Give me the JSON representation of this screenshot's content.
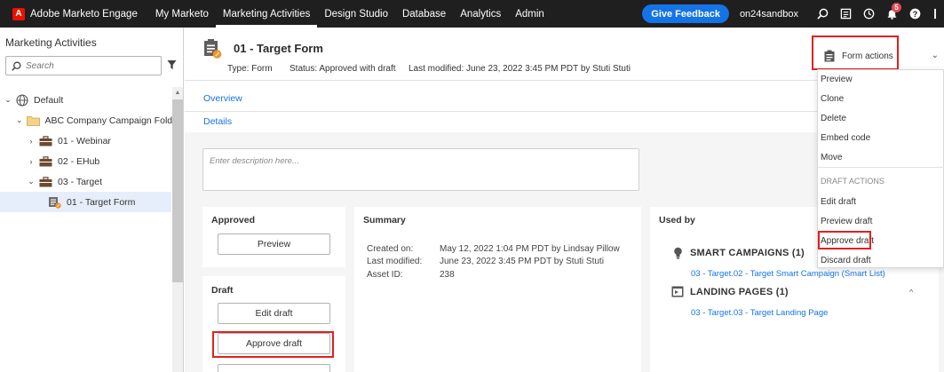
{
  "topnav": {
    "brand": "Adobe Marketo Engage",
    "items": [
      "My Marketo",
      "Marketing Activities",
      "Design Studio",
      "Database",
      "Analytics",
      "Admin"
    ],
    "feedback": "Give Feedback",
    "sandbox": "on24sandbox",
    "notification_count": "5"
  },
  "sidebar": {
    "title": "Marketing Activities",
    "search_placeholder": "Search",
    "tree": {
      "default": "Default",
      "folder": "ABC Company Campaign Folder",
      "webinar": "01 - Webinar",
      "ehub": "02 - EHub",
      "target": "03 - Target",
      "target_form": "01 - Target Form"
    }
  },
  "header": {
    "title": "01 - Target Form",
    "type": "Type: Form",
    "status": "Status: Approved with draft",
    "modified": "Last modified: June 23, 2022 3:45 PM PDT by Stuti Stuti"
  },
  "tabs": {
    "overview": "Overview",
    "details": "Details"
  },
  "description_placeholder": "Enter description here...",
  "approved": {
    "title": "Approved",
    "preview": "Preview"
  },
  "draft": {
    "title": "Draft",
    "edit": "Edit draft",
    "approve": "Approve draft"
  },
  "summary": {
    "title": "Summary",
    "created_label": "Created on:",
    "created_value": "May 12, 2022 1:04 PM PDT by Lindsay Pillow",
    "modified_label": "Last modified:",
    "modified_value": "June 23, 2022 3:45 PM PDT by Stuti Stuti",
    "asset_label": "Asset ID:",
    "asset_value": "238"
  },
  "used_by": {
    "title": "Used by",
    "smart_campaigns": "SMART CAMPAIGNS (1)",
    "smart_link": "03 - Target.02 - Target Smart Campaign (Smart List)",
    "landing_pages": "LANDING PAGES (1)",
    "landing_link": "03 - Target.03 - Target Landing Page"
  },
  "form_actions": {
    "label": "Form actions",
    "items": [
      "Preview",
      "Clone",
      "Delete",
      "Embed code",
      "Move"
    ],
    "draft_section": "DRAFT ACTIONS",
    "draft_items": [
      "Edit draft",
      "Preview draft",
      "Approve draft",
      "Discard draft"
    ]
  },
  "colors": {
    "accent": "#1473e6",
    "highlight": "#e02020",
    "nav": "#1f1f1f"
  }
}
